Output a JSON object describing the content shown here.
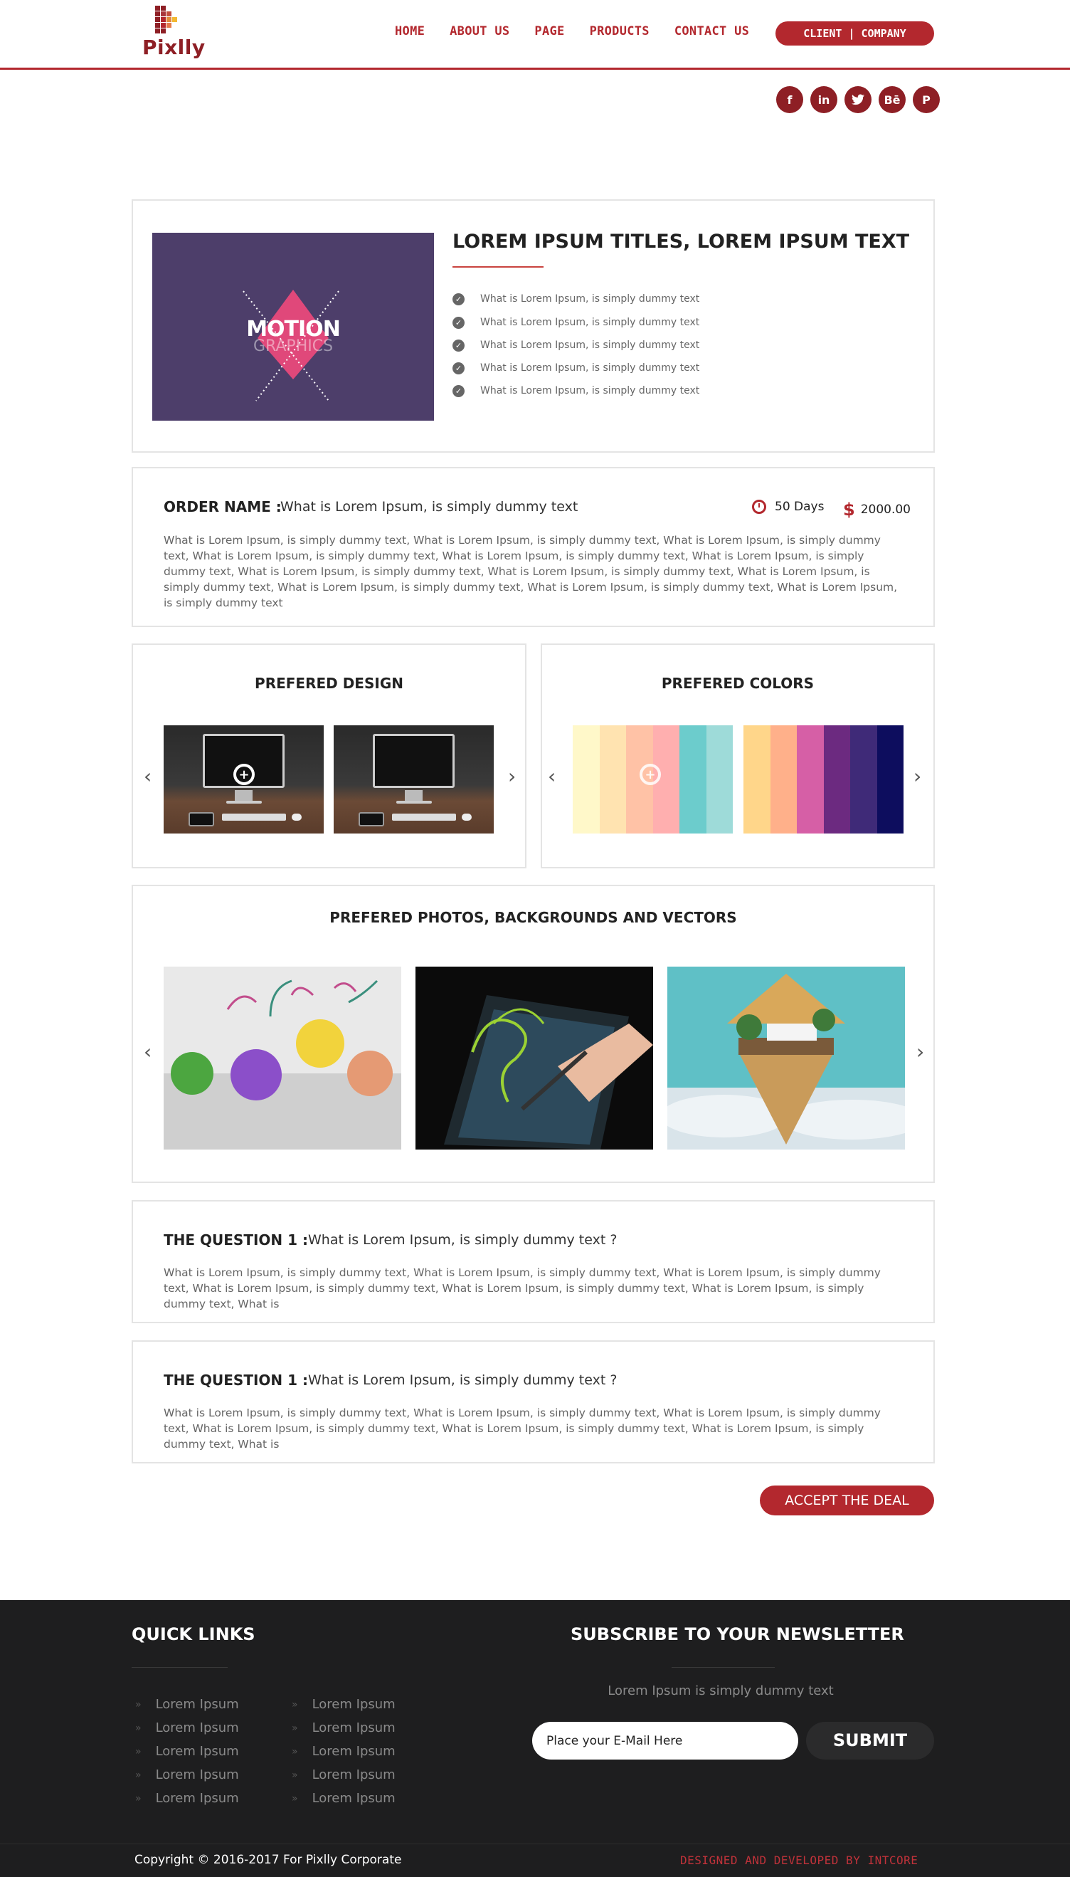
{
  "colors": {
    "accent": "#b3282e",
    "dark_accent": "#8e1f25",
    "footer_bg": "#1e1e1f"
  },
  "logo": {
    "text": "Pixlly"
  },
  "nav": {
    "items": [
      {
        "label": "HOME"
      },
      {
        "label": "ABOUT US"
      },
      {
        "label": "PAGE"
      },
      {
        "label": "PRODUCTS"
      },
      {
        "label": "CONTACT US"
      }
    ],
    "client_button": "CLIENT | COMPANY"
  },
  "social": [
    {
      "icon": "facebook-icon",
      "glyph": "f"
    },
    {
      "icon": "linkedin-icon",
      "glyph": "in"
    },
    {
      "icon": "twitter-icon",
      "glyph": "🐦"
    },
    {
      "icon": "behance-icon",
      "glyph": "Bē"
    },
    {
      "icon": "pinterest-icon",
      "glyph": "P"
    }
  ],
  "hero": {
    "image_text_1": "MOTION",
    "image_text_2": "GRAPHICS",
    "title": "LOREM IPSUM TITLES, LOREM IPSUM TEXT",
    "list": [
      "What is Lorem Ipsum, is simply dummy text",
      "What is Lorem Ipsum, is simply dummy text",
      "What is Lorem Ipsum, is simply dummy text",
      "What is Lorem Ipsum, is simply dummy text",
      "What is Lorem Ipsum, is simply dummy text"
    ]
  },
  "order": {
    "label": "ORDER NAME :",
    "value": "What is Lorem Ipsum, is simply dummy text",
    "days": "50 Days",
    "price": "2000.00",
    "description": "What is Lorem Ipsum, is simply dummy text, What is Lorem Ipsum, is simply dummy text, What is Lorem Ipsum, is simply dummy text, What is Lorem Ipsum, is simply dummy text, What is Lorem Ipsum, is simply dummy text, What is Lorem Ipsum, is simply dummy text, What is Lorem Ipsum, is simply dummy text, What is Lorem Ipsum, is simply dummy text, What is Lorem Ipsum, is simply dummy text, What is Lorem Ipsum, is simply dummy text, What is Lorem Ipsum, is simply dummy text, What is Lorem Ipsum, is simply dummy text"
  },
  "prefered_design": {
    "title": "PREFERED DESIGN"
  },
  "prefered_colors": {
    "title": "PREFERED COLORS",
    "palette_1": [
      "#fff8c9",
      "#ffe3b0",
      "#ffc2a6",
      "#ffafaf",
      "#6ccccc",
      "#9edbd9"
    ],
    "palette_2": [
      "#ffd68a",
      "#ffb08a",
      "#d65fa6",
      "#6c2a80",
      "#3f2a78",
      "#0d0d5e"
    ]
  },
  "prefered_photos": {
    "title": "PREFERED PHOTOS, BACKGROUNDS AND VECTORS"
  },
  "questions": [
    {
      "label": "THE QUESTION 1 :",
      "value": "What is Lorem Ipsum, is simply dummy text ?",
      "description": "What is Lorem Ipsum, is simply dummy text, What is Lorem Ipsum, is simply dummy text, What is Lorem Ipsum, is simply dummy text, What is Lorem Ipsum, is simply dummy text, What is Lorem Ipsum, is simply dummy text, What is Lorem Ipsum, is simply dummy text, What is"
    },
    {
      "label": "THE QUESTION 1 :",
      "value": "What is Lorem Ipsum, is simply dummy text ?",
      "description": "What is Lorem Ipsum, is simply dummy text, What is Lorem Ipsum, is simply dummy text, What is Lorem Ipsum, is simply dummy text, What is Lorem Ipsum, is simply dummy text, What is Lorem Ipsum, is simply dummy text, What is Lorem Ipsum, is simply dummy text, What is"
    }
  ],
  "accept_button": "ACCEPT THE DEAL",
  "footer": {
    "quick_links_title": "QUICK LINKS",
    "links_col1": [
      "Lorem Ipsum",
      "Lorem Ipsum",
      "Lorem Ipsum",
      "Lorem Ipsum",
      "Lorem Ipsum"
    ],
    "links_col2": [
      "Lorem Ipsum",
      "Lorem Ipsum",
      "Lorem Ipsum",
      "Lorem Ipsum",
      "Lorem Ipsum"
    ],
    "newsletter_title": "SUBSCRIBE TO YOUR NEWSLETTER",
    "newsletter_sub": "Lorem Ipsum is simply dummy text",
    "email_placeholder": "Place your E-Mail Here",
    "submit_label": "SUBMIT",
    "copyright": "Copyright  © 2016-2017 For Pixlly Corporate",
    "developed_by": "DESIGNED AND DEVELOPED BY INTCORE"
  }
}
